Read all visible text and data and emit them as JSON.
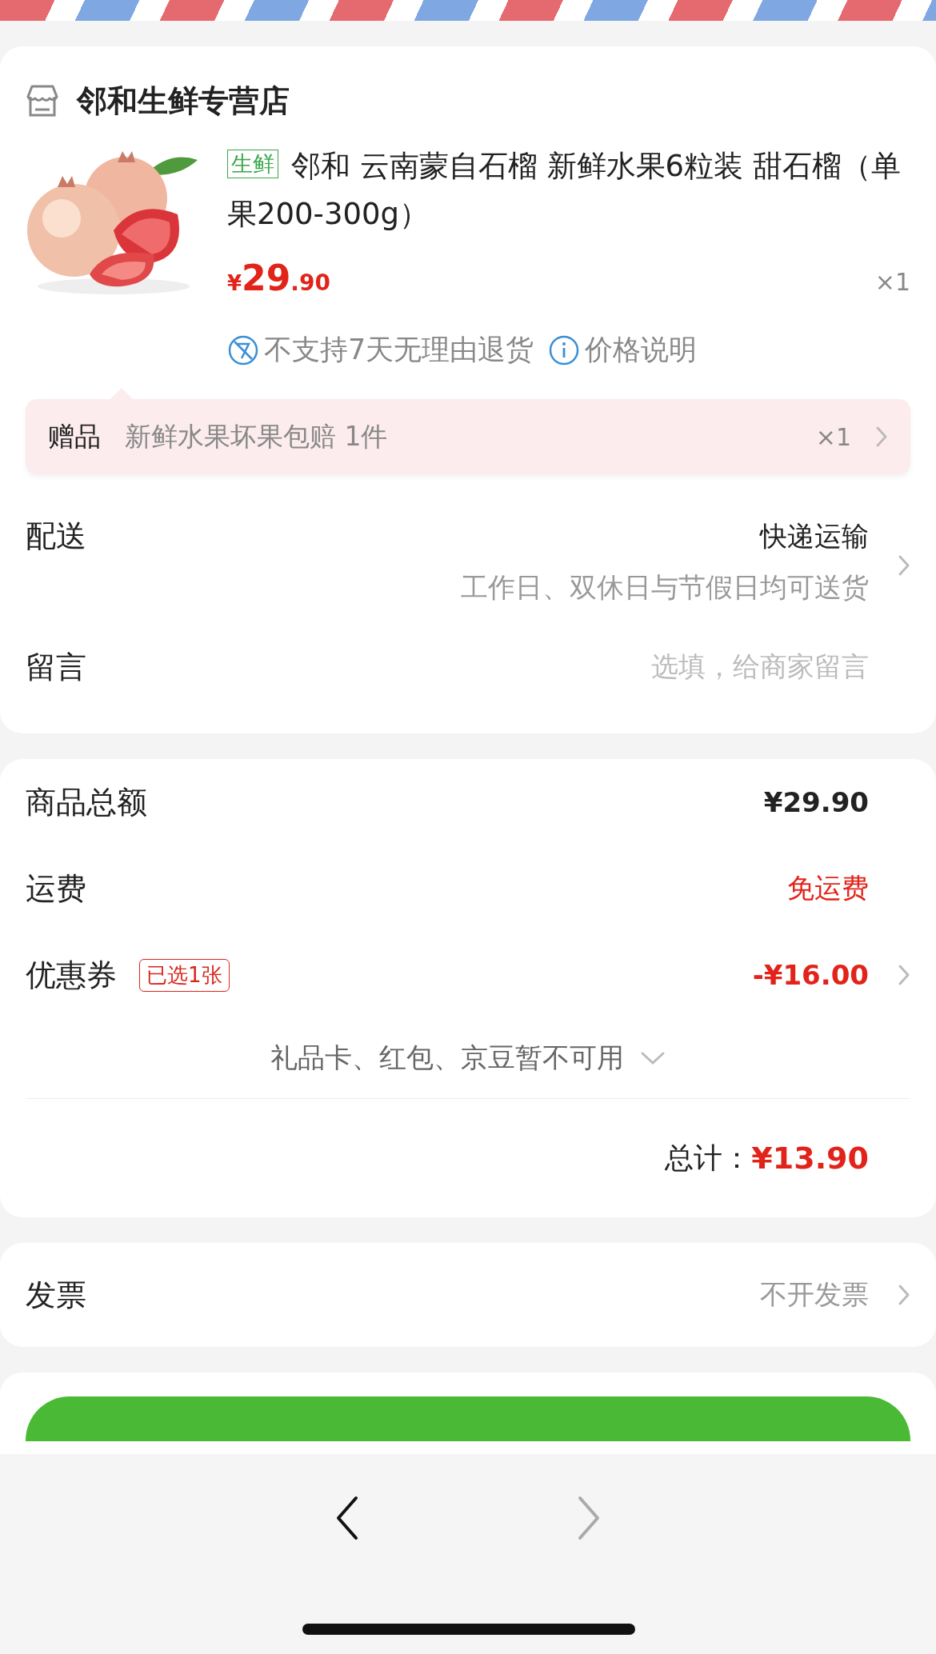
{
  "store": {
    "name": "邻和生鲜专营店"
  },
  "product": {
    "tag": "生鲜",
    "title": "邻和 云南蒙自石榴 新鲜水果6粒装 甜石榴（单果200-300g）",
    "price_symbol": "¥",
    "price_int": "29",
    "price_dec": ".90",
    "quantity": "×1"
  },
  "services": [
    {
      "kind": "no-return",
      "label": "不支持7天无理由退货"
    },
    {
      "kind": "info",
      "label": "价格说明"
    }
  ],
  "gift": {
    "label": "赠品",
    "text": "新鲜水果坏果包赔 1件",
    "quantity": "×1"
  },
  "delivery": {
    "label": "配送",
    "method": "快递运输",
    "note": "工作日、双休日与节假日均可送货"
  },
  "message": {
    "label": "留言",
    "placeholder": "选填，给商家留言"
  },
  "summary": [
    {
      "kind": "plain",
      "label": "商品总额",
      "value": "¥29.90"
    },
    {
      "kind": "highlight",
      "label": "运费",
      "value": "免运费"
    },
    {
      "kind": "coupon",
      "label": "优惠券",
      "badge": "已选1张",
      "value": "-¥16.00"
    }
  ],
  "unavailable": {
    "text": "礼品卡、红包、京豆暂不可用",
    "expanded": false
  },
  "total": {
    "label": "总计：",
    "value": "¥13.90"
  },
  "invoice": {
    "label": "发票",
    "value": "不开发票"
  },
  "nav": {
    "back": {
      "disabled": false
    },
    "forward": {
      "disabled": true
    }
  }
}
